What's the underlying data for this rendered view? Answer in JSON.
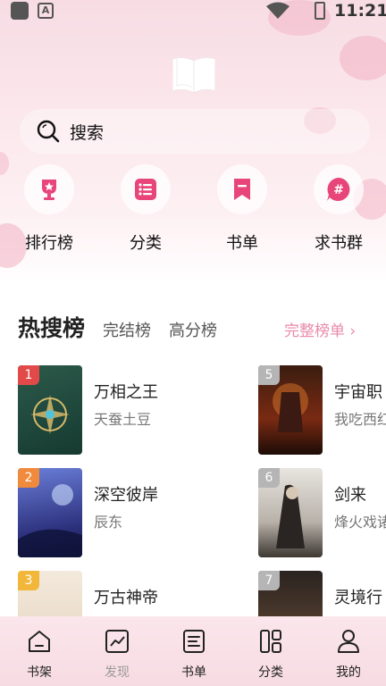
{
  "status_bar": {
    "time": "11:21",
    "app_badge": "A"
  },
  "search": {
    "label": "搜索"
  },
  "quick_nav": [
    {
      "label": "排行榜",
      "icon": "trophy-icon"
    },
    {
      "label": "分类",
      "icon": "category-list-icon"
    },
    {
      "label": "书单",
      "icon": "booklist-bookmark-icon"
    },
    {
      "label": "求书群",
      "icon": "hashtag-chat-icon"
    }
  ],
  "ranking": {
    "tabs": [
      "热搜榜",
      "完结榜",
      "高分榜"
    ],
    "full_list_link": "完整榜单 ›",
    "books": [
      {
        "rank": "1",
        "title": "万相之王",
        "author": "天蚕土豆"
      },
      {
        "rank": "2",
        "title": "深空彼岸",
        "author": "辰东"
      },
      {
        "rank": "3",
        "title": "万古神帝",
        "author": ""
      },
      {
        "rank": "5",
        "title": "宇宙职",
        "author": "我吃西红"
      },
      {
        "rank": "6",
        "title": "剑来",
        "author": "烽火戏诸"
      },
      {
        "rank": "7",
        "title": "灵境行",
        "author": ""
      }
    ]
  },
  "tab_bar": [
    {
      "label": "书架",
      "icon": "bookshelf-icon"
    },
    {
      "label": "发现",
      "icon": "trend-chart-icon"
    },
    {
      "label": "书单",
      "icon": "list-doc-icon"
    },
    {
      "label": "分类",
      "icon": "grid-category-icon"
    },
    {
      "label": "我的",
      "icon": "user-profile-icon"
    }
  ],
  "colors": {
    "accent_pink": "#e88aa8",
    "rank_1": "#e24a4a",
    "rank_2": "#f08a3c",
    "rank_3": "#f2b73a",
    "rank_other": "#b5b5b5",
    "icon_pink": "#e8457a"
  }
}
